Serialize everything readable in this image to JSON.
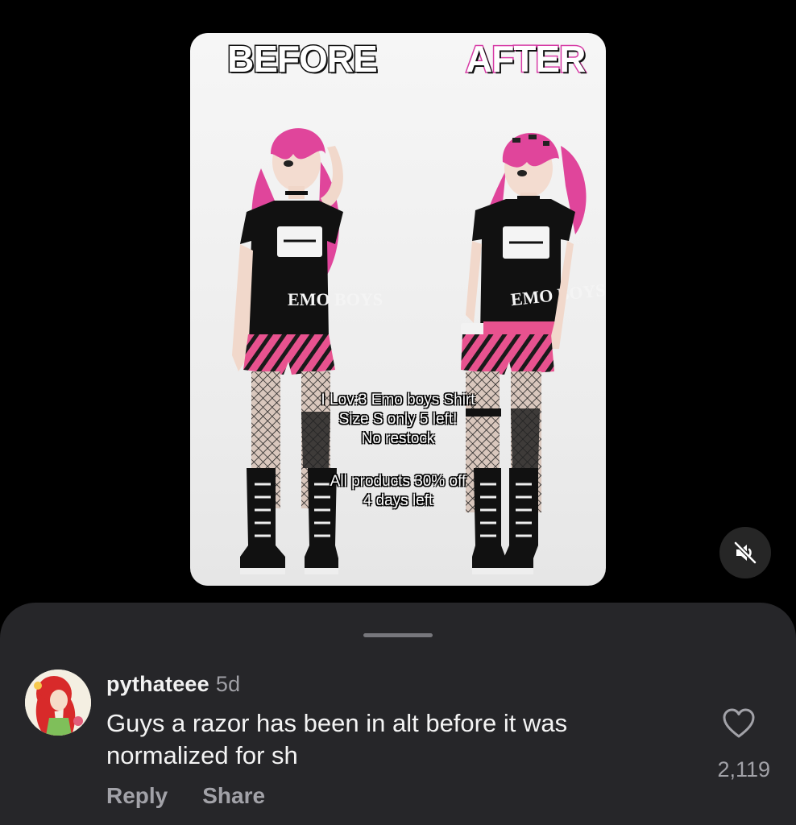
{
  "media": {
    "before_label": "BEFORE",
    "after_label": "AFTER",
    "shirt_text": "EMO BOYS",
    "overlay_line1": "I Lov:3 Emo boys Shirt",
    "overlay_line2": "Size S only 5 left!",
    "overlay_line3": "No restock",
    "overlay_line4": "All products 30% off",
    "overlay_line5": "4 days left",
    "mute_icon": "speaker-muted-icon"
  },
  "comment": {
    "username": "pythateee",
    "timestamp": "5d",
    "text": "Guys a razor has been in alt before it was normalized for sh",
    "reply_label": "Reply",
    "share_label": "Share",
    "like_icon": "heart-outline-icon",
    "like_count": "2,119"
  },
  "colors": {
    "background": "#000000",
    "sheet": "#262629",
    "accent_pink": "#e0459b",
    "secondary_text": "#a2a2a8"
  }
}
